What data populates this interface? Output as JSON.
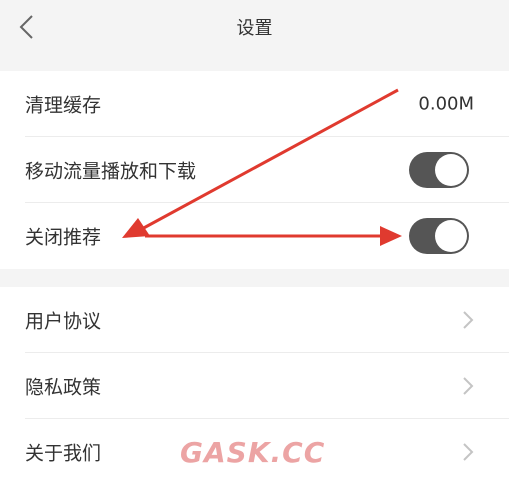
{
  "header": {
    "title": "设置",
    "back_icon": "chevron-left-icon"
  },
  "settings_group_1": {
    "items": [
      {
        "label": "清理缓存",
        "value": "0.00M"
      },
      {
        "label": "移动流量播放和下载",
        "toggle_on": true
      },
      {
        "label": "关闭推荐",
        "toggle_on": true
      }
    ]
  },
  "settings_group_2": {
    "items": [
      {
        "label": "用户协议",
        "icon": "chevron-right-icon"
      },
      {
        "label": "隐私政策",
        "icon": "chevron-right-icon"
      },
      {
        "label": "关于我们",
        "icon": "chevron-right-icon"
      }
    ]
  },
  "annotation": {
    "arrow_color": "#e03a2f"
  },
  "watermark": {
    "text": "GASK.CC"
  },
  "colors": {
    "toggle_on": "#555555",
    "background": "#f4f4f4"
  }
}
